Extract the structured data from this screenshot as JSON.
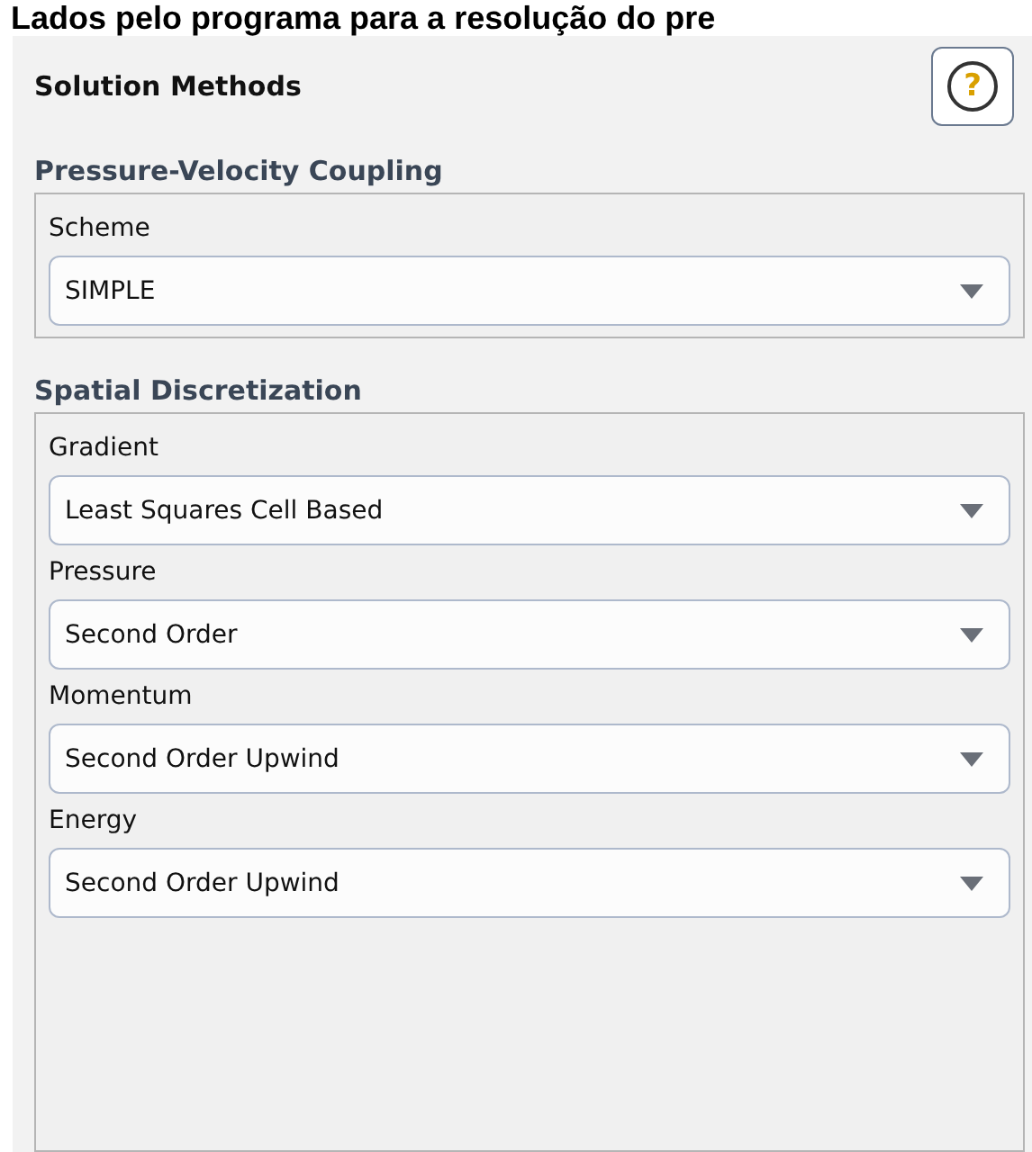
{
  "caption": "Lados pelo programa para a resolução do pre",
  "panel": {
    "title": "Solution Methods",
    "help_button": "?"
  },
  "groups": [
    {
      "title": "Pressure-Velocity Coupling",
      "fields": [
        {
          "label": "Scheme",
          "value": "SIMPLE"
        }
      ]
    },
    {
      "title": "Spatial Discretization",
      "fields": [
        {
          "label": "Gradient",
          "value": "Least Squares Cell Based"
        },
        {
          "label": "Pressure",
          "value": "Second Order"
        },
        {
          "label": "Momentum",
          "value": "Second Order Upwind"
        },
        {
          "label": "Energy",
          "value": "Second Order Upwind"
        }
      ]
    }
  ]
}
